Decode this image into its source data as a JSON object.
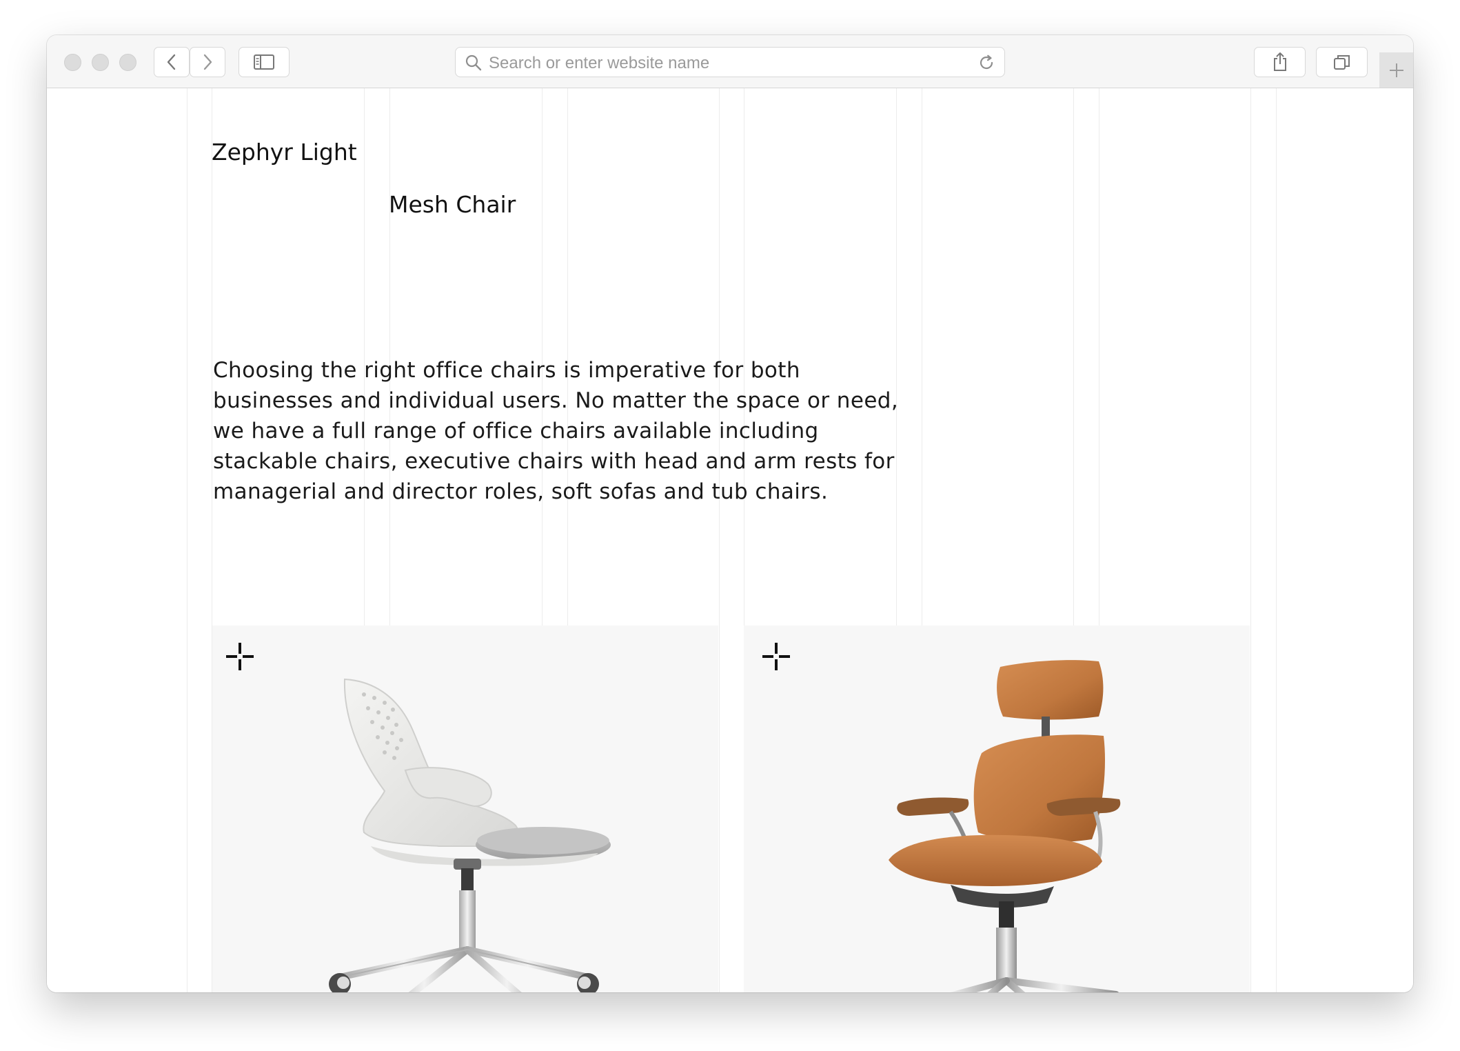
{
  "browser": {
    "address_placeholder": "Search or enter website name",
    "icons": [
      "traffic-lights",
      "back-icon",
      "forward-icon",
      "sidebar-icon",
      "search-icon",
      "reload-icon",
      "share-icon",
      "tabs-icon",
      "plus-icon"
    ]
  },
  "page": {
    "title_line1": "Zephyr Light",
    "title_line2": "Mesh Chair",
    "description": "Choosing the right office chairs is imperative for both businesses and individual users. No matter the space or need, we have a full range of office chairs available including stackable chairs, executive chairs with head and arm rests for managerial and director roles, soft sofas and tub chairs.",
    "products": [
      {
        "image": "white-swivel-chair",
        "icon": "crosshair-plus-icon"
      },
      {
        "image": "tan-leather-executive-chair",
        "icon": "crosshair-plus-icon"
      }
    ]
  },
  "colors": {
    "card_bg": "#f7f7f7",
    "grid_line": "#ececec",
    "text": "#111111",
    "leather": "#c27a43"
  }
}
